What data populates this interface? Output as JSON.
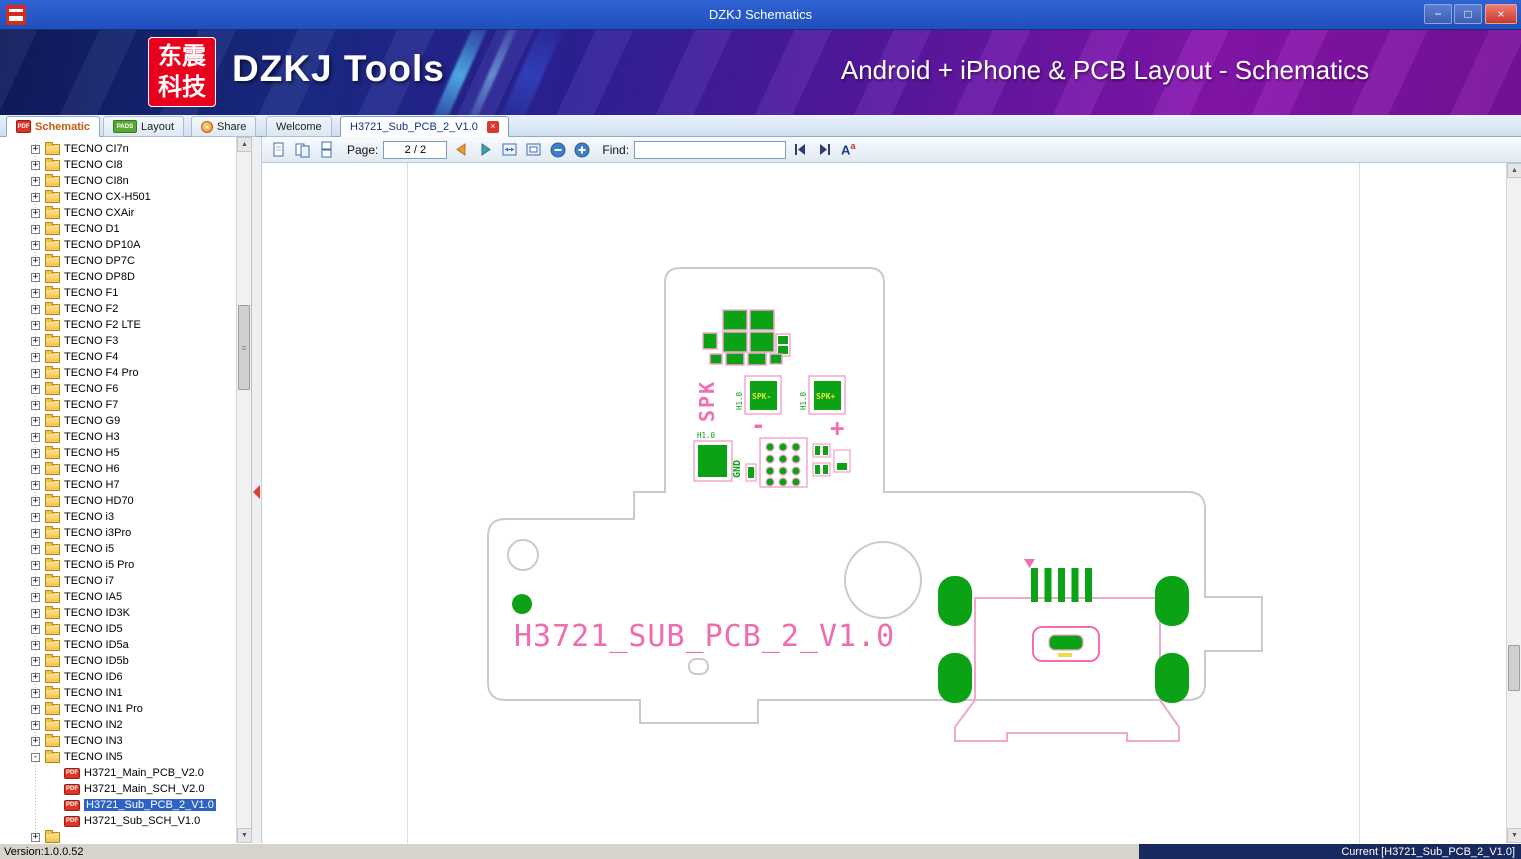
{
  "window": {
    "title": "DZKJ Schematics",
    "minimize_glyph": "−",
    "maximize_glyph": "□",
    "close_glyph": "×"
  },
  "banner": {
    "logo_top": "东震",
    "logo_bottom": "科技",
    "brand": "DZKJ Tools",
    "subtitle": "Android + iPhone & PCB Layout - Schematics"
  },
  "tabs": {
    "pdf_badge": "PDF",
    "pads_badge": "PADS",
    "schematic": "Schematic",
    "layout": "Layout",
    "share": "Share",
    "close_glyph": "×",
    "documents": [
      {
        "label": "Welcome"
      },
      {
        "label": "H3721_Sub_PCB_2_V1.0"
      }
    ]
  },
  "toolbar": {
    "page_label": "Page:",
    "page_value": "2 / 2",
    "find_label": "Find:",
    "find_value": "",
    "case_main": "A",
    "case_sup": "a"
  },
  "sidebar": {
    "pdf_badge": "PDF",
    "folders": [
      "TECNO CI7n",
      "TECNO CI8",
      "TECNO CI8n",
      "TECNO CX-H501",
      "TECNO CXAir",
      "TECNO D1",
      "TECNO DP10A",
      "TECNO DP7C",
      "TECNO DP8D",
      "TECNO F1",
      "TECNO F2",
      "TECNO F2 LTE",
      "TECNO F3",
      "TECNO F4",
      "TECNO F4 Pro",
      "TECNO F6",
      "TECNO F7",
      "TECNO G9",
      "TECNO H3",
      "TECNO H5",
      "TECNO H6",
      "TECNO H7",
      "TECNO HD70",
      "TECNO i3",
      "TECNO i3Pro",
      "TECNO i5",
      "TECNO i5 Pro",
      "TECNO i7",
      "TECNO IA5",
      "TECNO ID3K",
      "TECNO ID5",
      "TECNO ID5a",
      "TECNO ID5b",
      "TECNO ID6",
      "TECNO IN1",
      "TECNO IN1 Pro",
      "TECNO IN2",
      "TECNO IN3"
    ],
    "expanded_folder": "TECNO IN5",
    "files": [
      "H3721_Main_PCB_V2.0",
      "H3721_Main_SCH_V2.0",
      "H3721_Sub_PCB_2_V1.0",
      "H3721_Sub_SCH_V1.0"
    ],
    "selected_file": "H3721_Sub_PCB_2_V1.0"
  },
  "pcb": {
    "title": "H3721_SUB_PCB_2_V1.0",
    "labels": {
      "spk": "SPK",
      "spk_minus": "SPK-",
      "spk_plus": "SPK+",
      "minus": "-",
      "plus": "+",
      "gnd": "GND",
      "h10": "H1.0"
    },
    "colors": {
      "pad_green": "#0ca216",
      "courtyard_pink": "#f2a8cb",
      "silk_pink": "#f06eb1",
      "board_gray": "#c9c9d2",
      "label_yellow": "#e8e13a"
    }
  },
  "statusbar": {
    "version": "Version:1.0.0.52",
    "current": "Current [H3721_Sub_PCB_2_V1.0]"
  }
}
